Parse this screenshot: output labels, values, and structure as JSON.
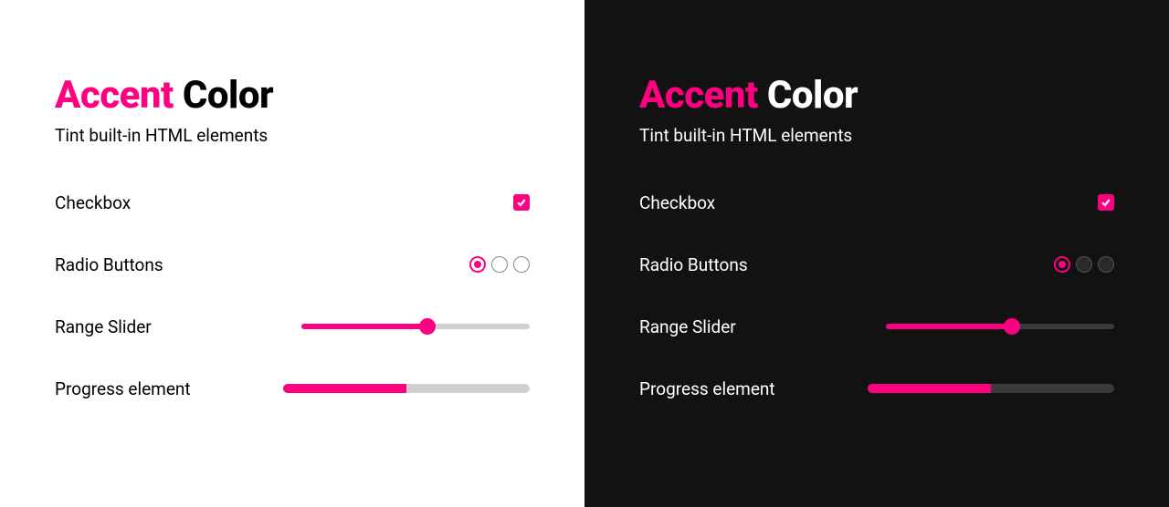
{
  "accent_color": "#ff0080",
  "heading": {
    "word1": "Accent",
    "word2": "Color"
  },
  "subtitle": "Tint built-in HTML elements",
  "controls": {
    "checkbox": {
      "label": "Checkbox",
      "checked": true
    },
    "radio": {
      "label": "Radio Buttons",
      "options": [
        true,
        false,
        false
      ]
    },
    "slider": {
      "label": "Range Slider",
      "value": 55,
      "min": 0,
      "max": 100
    },
    "progress": {
      "label": "Progress element",
      "value": 50,
      "max": 100
    }
  }
}
